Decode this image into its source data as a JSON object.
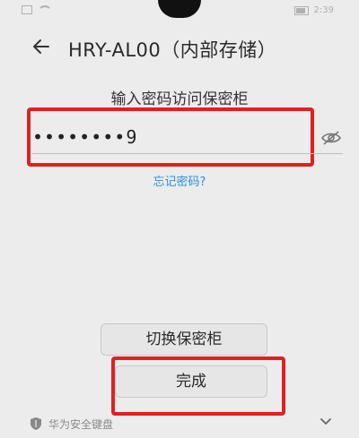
{
  "status": {
    "time": "2:39"
  },
  "header": {
    "title": "HRY-AL00（内部存储）"
  },
  "vault": {
    "prompt": "输入密码访问保密柜",
    "password_value": "••••••••9",
    "forgot_label": "忘记密码?",
    "switch_label": "切换保密柜",
    "done_label": "完成"
  },
  "keyboard": {
    "label": "华为安全键盘"
  },
  "colors": {
    "highlight": "#e12020",
    "link": "#2b8fd8",
    "background": "#ececec"
  }
}
